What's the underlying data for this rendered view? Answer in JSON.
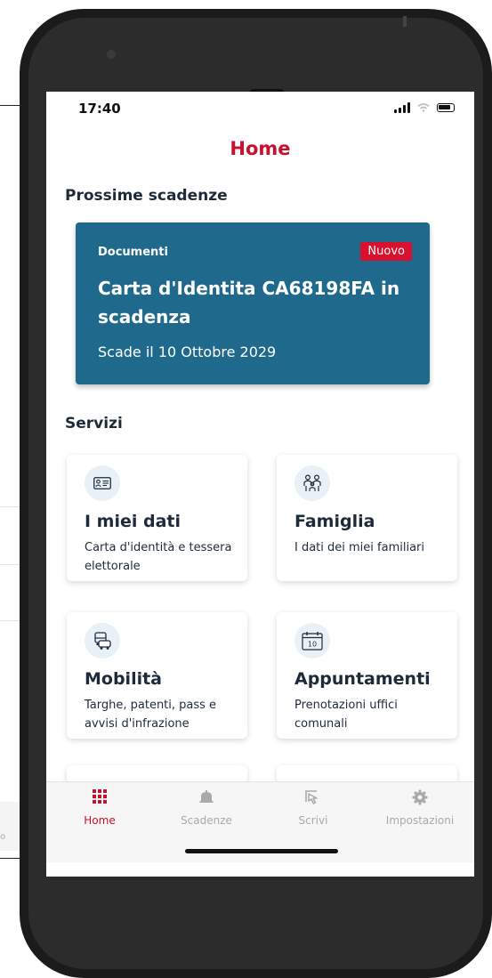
{
  "status_bar": {
    "time": "17:40"
  },
  "header": {
    "title": "Home"
  },
  "deadlines": {
    "section_title": "Prossime scadenze",
    "card": {
      "category": "Documenti",
      "badge": "Nuovo",
      "title": "Carta d'Identita CA68198FA in scadenza",
      "subtitle": "Scade il 10 Ottobre 2029"
    }
  },
  "services": {
    "section_title": "Servizi",
    "items": [
      {
        "icon": "id-card-icon",
        "title": "I miei dati",
        "description": "Carta d'identità e tessera elettorale"
      },
      {
        "icon": "family-icon",
        "title": "Famiglia",
        "description": "I dati dei miei familiari"
      },
      {
        "icon": "car-icon",
        "title": "Mobilità",
        "description": "Targhe, patenti, pass e avvisi d'infrazione"
      },
      {
        "icon": "calendar-icon",
        "title": "Appuntamenti",
        "description": "Prenotazioni uffici comunali",
        "calendar_day": "10"
      }
    ]
  },
  "tabbar": {
    "items": [
      {
        "label": "Home",
        "icon": "grid-icon",
        "active": true
      },
      {
        "label": "Scadenze",
        "icon": "bell-icon",
        "active": false
      },
      {
        "label": "Scrivi",
        "icon": "cursor-icon",
        "active": false
      },
      {
        "label": "Impostazioni",
        "icon": "gear-icon",
        "active": false
      }
    ]
  },
  "background_screen": {
    "tab_label": "azio"
  },
  "colors": {
    "brand_red": "#c8102e",
    "card_blue": "#1f6a8c",
    "badge_red": "#d8112f",
    "text_dark": "#1e2a3a",
    "tab_inactive": "#a9a9a9"
  }
}
